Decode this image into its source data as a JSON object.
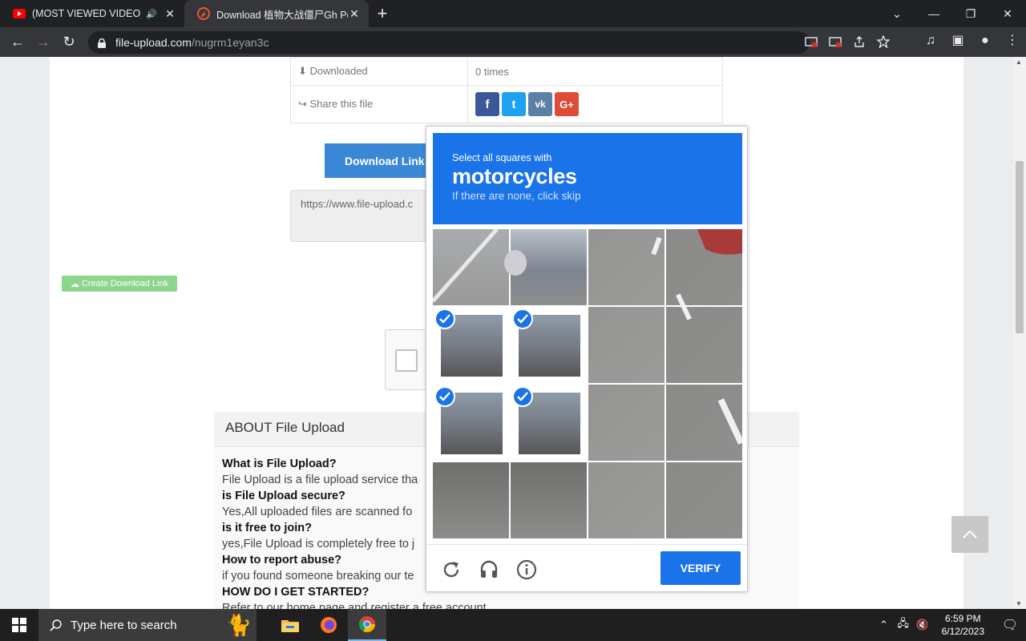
{
  "browser": {
    "tabs": [
      {
        "title": "(MOST VIEWED VIDEO) Barn",
        "audio": "🔊",
        "close": "✕"
      },
      {
        "title": "Download 植物大战僵尸Gh Perfe",
        "close": "✕"
      }
    ],
    "new_tab": "+",
    "url_host": "file-upload.com",
    "url_path": "/nugrm1eyan3c"
  },
  "file_info": {
    "downloaded_label": "Downloaded",
    "downloaded_value": "0 times",
    "share_label": "Share this file",
    "social": [
      "f",
      "t",
      "vk",
      "G+"
    ]
  },
  "page": {
    "download_link_button": "Download Link",
    "url_box_text": "https://www.file-upload.c",
    "create_download_link": "Create Download Link"
  },
  "about": {
    "heading": "ABOUT File Upload",
    "items": [
      {
        "q": "What is File Upload?",
        "a": "File Upload is a file upload service tha"
      },
      {
        "q": "is File Upload secure?",
        "a": "Yes,All uploaded files are scanned fo"
      },
      {
        "q": "is it free to join?",
        "a": "yes,File Upload is completely free to j"
      },
      {
        "q": "How to report abuse?",
        "a": "if you found someone breaking our te"
      },
      {
        "q": "HOW DO I GET STARTED?",
        "a": "Refer to our home page and register a free account"
      }
    ]
  },
  "captcha": {
    "instruction": "Select all squares with",
    "target": "motorcycles",
    "hint": "If there are none, click skip",
    "verify": "VERIFY",
    "selected_tiles": [
      4,
      5,
      8,
      9
    ]
  },
  "taskbar": {
    "search_placeholder": "Type here to search",
    "time": "6:59 PM",
    "date": "6/12/2023"
  },
  "colors": {
    "captcha_blue": "#1a73e8",
    "download_btn": "#3a87d6",
    "create_btn": "#8dd48d"
  }
}
